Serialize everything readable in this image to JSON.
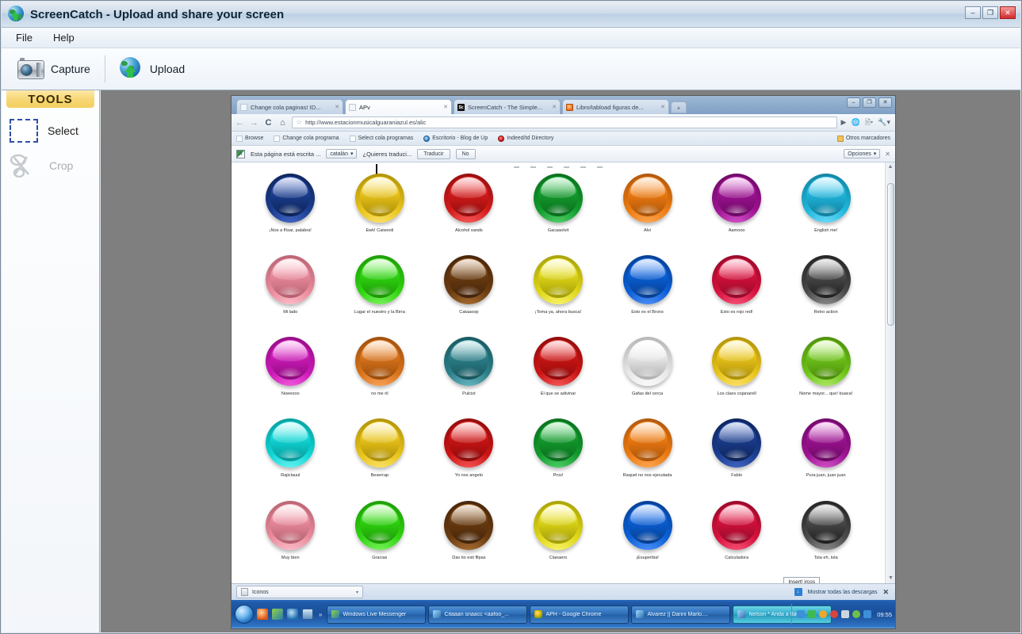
{
  "app": {
    "title": "ScreenCatch - Upload and share your screen",
    "icon": "globe-upload-icon",
    "window_controls": {
      "minimize": "–",
      "maximize": "❐",
      "close": "✕"
    },
    "menu": [
      {
        "label": "File",
        "name": "menu-file"
      },
      {
        "label": "Help",
        "name": "menu-help"
      }
    ],
    "toolbar": [
      {
        "label": "Capture",
        "icon": "camera-icon",
        "name": "capture-button"
      },
      {
        "label": "Upload",
        "icon": "globe-upload-icon",
        "name": "upload-button"
      }
    ],
    "sidebar": {
      "header": "TOOLS",
      "items": [
        {
          "label": "Select",
          "icon": "dashed-rectangle-icon",
          "name": "tool-select",
          "enabled": true
        },
        {
          "label": "Crop",
          "icon": "scissors-icon",
          "name": "tool-crop",
          "enabled": false
        }
      ]
    }
  },
  "screenshot": {
    "browser": {
      "tabs": [
        {
          "label": "Change cola paginas! ID...",
          "favicon": "page-icon",
          "active": false
        },
        {
          "label": "APv",
          "favicon": "page-icon",
          "active": true
        },
        {
          "label": "ScreenCatch - The Simple...",
          "favicon": "screencatch-icon",
          "active": false
        },
        {
          "label": "Libro/tabload figuras de...",
          "favicon": "firefox-icon",
          "active": false
        }
      ],
      "new_tab": "+",
      "window_controls": {
        "minimize": "–",
        "maximize": "❐",
        "close": "✕"
      },
      "nav": {
        "back": "←",
        "forward": "→",
        "reload": "C",
        "home": "⌂",
        "bookmark_star": "☆",
        "go": "▶"
      },
      "url": "http://www.estacionmusicalguaraniazul.es/alic",
      "omni_right": [
        {
          "icon": "extension-globe-icon"
        },
        {
          "icon": "page-menu-icon"
        },
        {
          "icon": "wrench-menu-icon"
        }
      ],
      "bookmarks": [
        {
          "label": "Browse",
          "icon": "page-icon"
        },
        {
          "label": "Change cola programa",
          "icon": "page-icon"
        },
        {
          "label": "Select cola programas",
          "icon": "page-icon"
        },
        {
          "label": "Escritorio - Blog de Up",
          "icon": "blue-dot-icon"
        },
        {
          "label": "Indeed/td Directory",
          "icon": "red-dot-icon"
        }
      ],
      "bookmarks_other": {
        "label": "Otros marcadores",
        "icon": "folder-icon"
      },
      "translate_bar": {
        "icon": "translate-icon",
        "message": "Esta página está escrita ...",
        "language": "catalán",
        "question": "¿Quieres traduci...",
        "translate_button": "Traducir",
        "no_button": "No",
        "options_button": "Opciones",
        "close": "✕"
      }
    },
    "page": {
      "rows": [
        [
          {
            "caption": "¡Nos a flísar, palabra!",
            "color": "#1b3d8f",
            "dark": "#0d2356",
            "light": "#4a6fd0"
          },
          {
            "caption": "Ewk! Caiwooli",
            "color": "#e8c31a",
            "dark": "#a98c08",
            "light": "#ffe87a"
          },
          {
            "caption": "Alcohol sands",
            "color": "#d21a1a",
            "dark": "#8f0d0d",
            "light": "#ff6a6a"
          },
          {
            "caption": "Gacaaolvit",
            "color": "#129a2c",
            "dark": "#0a6b1e",
            "light": "#5fdc77"
          },
          {
            "caption": "Alvi",
            "color": "#ec7a10",
            "dark": "#a8530a",
            "light": "#ffb163"
          },
          {
            "caption": "Aamooo",
            "color": "#9c1191",
            "dark": "#6a0a62",
            "light": "#df62d4"
          },
          {
            "caption": "English me!",
            "color": "#1fb5dc",
            "dark": "#117f9c",
            "light": "#7fe4ff"
          }
        ],
        [
          {
            "caption": "Mi lado",
            "color": "#e98b9c",
            "dark": "#b35e6e",
            "light": "#ffc8d2"
          },
          {
            "caption": "Lugar el nuestro y la Birra",
            "color": "#2ed40f",
            "dark": "#1d9408",
            "light": "#8cf96f"
          },
          {
            "caption": "Cataaoop",
            "color": "#6a3b10",
            "dark": "#43240a",
            "light": "#b5793a"
          },
          {
            "caption": "¡Toma ya, ahora busca!",
            "color": "#ded617",
            "dark": "#a09a08",
            "light": "#fff97e"
          },
          {
            "caption": "Esto es el Bronx",
            "color": "#0a5fd6",
            "dark": "#063d8c",
            "light": "#5e9bff"
          },
          {
            "caption": "Esto es rojo red!",
            "color": "#d6103c",
            "dark": "#900a28",
            "light": "#ff6184"
          },
          {
            "caption": "Retro action",
            "color": "#4a4a4a",
            "dark": "#1f1f1f",
            "light": "#9a9a9a"
          }
        ],
        [
          {
            "caption": "Noeeooo",
            "color": "#cc18b7",
            "dark": "#8c0d7d",
            "light": "#f96be6"
          },
          {
            "caption": "no me ril",
            "color": "#d9721a",
            "dark": "#964c0c",
            "light": "#ffae66"
          },
          {
            "caption": "Pulcist",
            "color": "#2c7f89",
            "dark": "#17545b",
            "light": "#76c3cc"
          },
          {
            "caption": "El que se adivinar",
            "color": "#cc1414",
            "dark": "#8a0b0b",
            "light": "#ff6666"
          },
          {
            "caption": "Gafas del cerca",
            "color": "#e8e8e8",
            "dark": "#aeaeae",
            "light": "#ffffff"
          },
          {
            "caption": "Los claes cojanarell",
            "color": "#e8c31a",
            "dark": "#a98c08",
            "light": "#ffe87a"
          },
          {
            "caption": "Nome mayor... que! buaca!",
            "color": "#6ec41a",
            "dark": "#4a880b",
            "light": "#bdf176"
          }
        ],
        [
          {
            "caption": "Rajiclauul",
            "color": "#0fd6d6",
            "dark": "#089797",
            "light": "#7ff7f7"
          },
          {
            "caption": "Beserrap",
            "color": "#e8c31a",
            "dark": "#a98c08",
            "light": "#ffe87a"
          },
          {
            "caption": "Yo nos angelo",
            "color": "#cc1414",
            "dark": "#8a0b0b",
            "light": "#ff6666"
          },
          {
            "caption": "Pros!",
            "color": "#129a2c",
            "dark": "#0a6b1e",
            "light": "#5fdc77"
          },
          {
            "caption": "Raquel no nos ejecutada",
            "color": "#ec7a10",
            "dark": "#a8530a",
            "light": "#ffb163"
          },
          {
            "caption": "Fablo",
            "color": "#1b3d8f",
            "dark": "#0d2356",
            "light": "#4a6fd0"
          },
          {
            "caption": "Pura juan, juan juan",
            "color": "#9c1191",
            "dark": "#6a0a62",
            "light": "#df62d4"
          }
        ],
        [
          {
            "caption": "Muy bien",
            "color": "#e98b9c",
            "dark": "#b35e6e",
            "light": "#ffc8d2"
          },
          {
            "caption": "Gracias",
            "color": "#2ed40f",
            "dark": "#1d9408",
            "light": "#8cf96f"
          },
          {
            "caption": "Dav tio esti fllpas",
            "color": "#6a3b10",
            "dark": "#43240a",
            "light": "#b5793a"
          },
          {
            "caption": "Claeaero",
            "color": "#ded617",
            "dark": "#a09a08",
            "light": "#fff97e"
          },
          {
            "caption": "¡Esuperbia!",
            "color": "#0a5fd6",
            "dark": "#063d8c",
            "light": "#5e9bff"
          },
          {
            "caption": "Calculadora",
            "color": "#d6103c",
            "dark": "#900a28",
            "light": "#ff6184"
          },
          {
            "caption": "Tsta eh, tsta",
            "color": "#4a4a4a",
            "dark": "#1f1f1f",
            "light": "#9a9a9a"
          }
        ]
      ],
      "tooltip": "Insert! ircos"
    },
    "download_shelf": {
      "item": "Iconos",
      "item_caret": "▾",
      "show_all": "Mostrar todas las descargas",
      "close": "✕"
    },
    "taskbar": {
      "start": "start-orb",
      "quick_launch": [
        "firefox-icon",
        "msn-icon",
        "network-icon",
        "desktop-icon"
      ],
      "quick_more": "»",
      "items": [
        {
          "label": "Windows Live Messenger",
          "icon": "msn-icon",
          "active": false
        },
        {
          "label": "Citaaan snaacc <aafoo_...",
          "icon": "chat-icon",
          "active": false
        },
        {
          "label": "APH - Google Chrome",
          "icon": "chrome-icon",
          "active": false
        },
        {
          "label": "Alvarez || Danni Marlo....",
          "icon": "word-icon",
          "active": false
        },
        {
          "label": "Nelson * Anda a Itaue",
          "icon": "word-icon",
          "active": true
        }
      ],
      "tray": [
        "network-icon",
        "sync-icon",
        "shield-icon",
        "alert-icon",
        "gfx-icon",
        "user-icon",
        "volume-icon"
      ],
      "clock": "09:55"
    }
  }
}
